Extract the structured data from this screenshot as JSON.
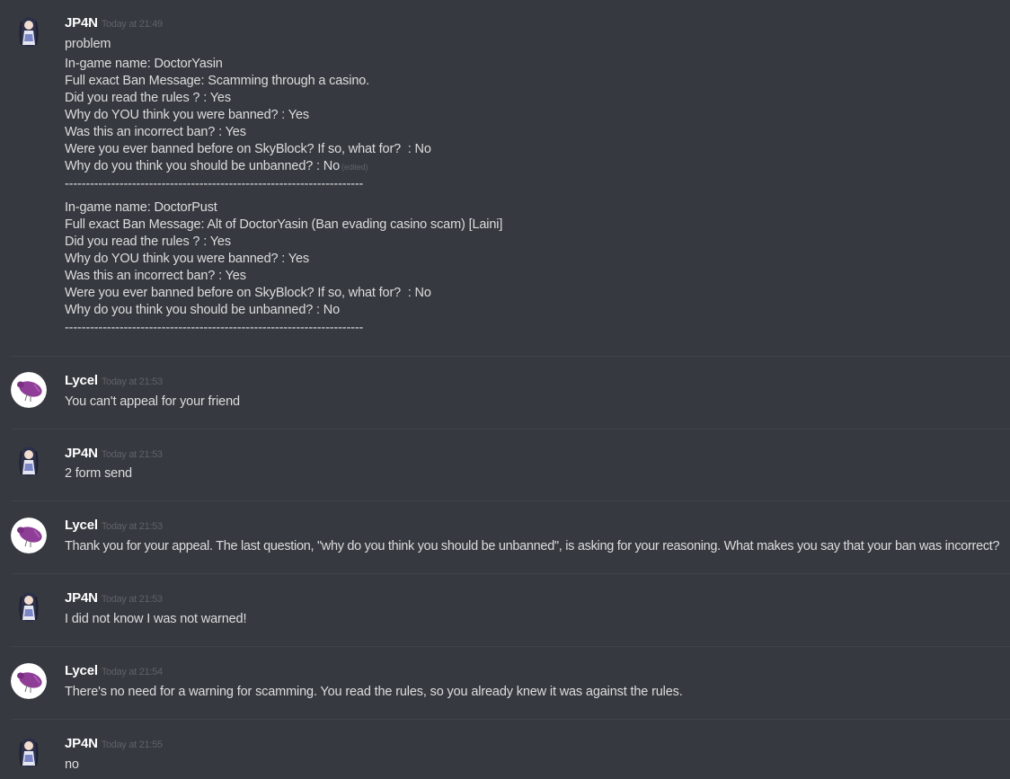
{
  "messages": [
    {
      "author": "JP4N",
      "timestamp": "Today at 21:49",
      "lines": [
        "problem",
        "In-game name: DoctorYasin",
        "Full exact Ban Message: Scamming through a casino.",
        "Did you read the rules ? : Yes",
        "Why do YOU think you were banned? : Yes",
        "Was this an incorrect ban? : Yes",
        "Were you ever banned before on SkyBlock? If so, what for?  : No",
        "Why do you think you should be unbanned? : No",
        "-----------------------------------------------------------------------",
        "",
        "In-game name: DoctorPust",
        "Full exact Ban Message: Alt of DoctorYasin (Ban evading casino scam) [Laini]",
        "Did you read the rules ? : Yes",
        "Why do YOU think you were banned? : Yes",
        "Was this an incorrect ban? : Yes",
        "Were you ever banned before on SkyBlock? If so, what for?  : No",
        "Why do you think you should be unbanned? : No",
        "-----------------------------------------------------------------------"
      ],
      "edited_label": "(edited)"
    },
    {
      "author": "Lycel",
      "timestamp": "Today at 21:53",
      "lines": [
        "You can't appeal for your friend"
      ]
    },
    {
      "author": "JP4N",
      "timestamp": "Today at 21:53",
      "lines": [
        "2 form send"
      ]
    },
    {
      "author": "Lycel",
      "timestamp": "Today at 21:53",
      "lines": [
        "Thank you for your appeal. The last question, \"why do you think you should be unbanned\", is asking for your reasoning. What makes you say that your ban was incorrect?"
      ]
    },
    {
      "author": "JP4N",
      "timestamp": "Today at 21:53",
      "lines": [
        "I did not know I was not warned!"
      ]
    },
    {
      "author": "Lycel",
      "timestamp": "Today at 21:54",
      "lines": [
        "There's no need for a warning for scamming. You read the rules, so you already knew it was against the rules."
      ]
    },
    {
      "author": "JP4N",
      "timestamp": "Today at 21:55",
      "lines": [
        "no"
      ]
    }
  ],
  "colors": {
    "background": "#36393f",
    "username": "#ffffff",
    "text": "#dcddde",
    "timestamp": "#5f6267",
    "divider": "#40434a",
    "lycel_avatar_bird": "#8e3e96"
  },
  "icons": {
    "jp4n_avatar": "anime-character-avatar-icon",
    "lycel_avatar": "purple-bird-avatar-icon"
  }
}
